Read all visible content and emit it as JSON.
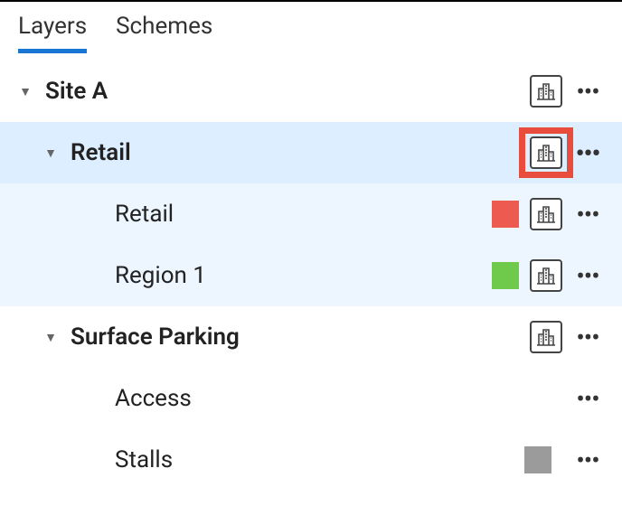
{
  "tabs": {
    "layers": "Layers",
    "schemes": "Schemes"
  },
  "tree": {
    "siteA": "Site A",
    "retail_group": "Retail",
    "retail_item": "Retail",
    "region1": "Region 1",
    "surface_parking": "Surface Parking",
    "access": "Access",
    "stalls": "Stalls"
  },
  "colors": {
    "retail_swatch": "#ed5a4f",
    "region1_swatch": "#6fc94a",
    "stalls_swatch": "#9b9b9b"
  },
  "icons": {
    "more": "•••"
  }
}
